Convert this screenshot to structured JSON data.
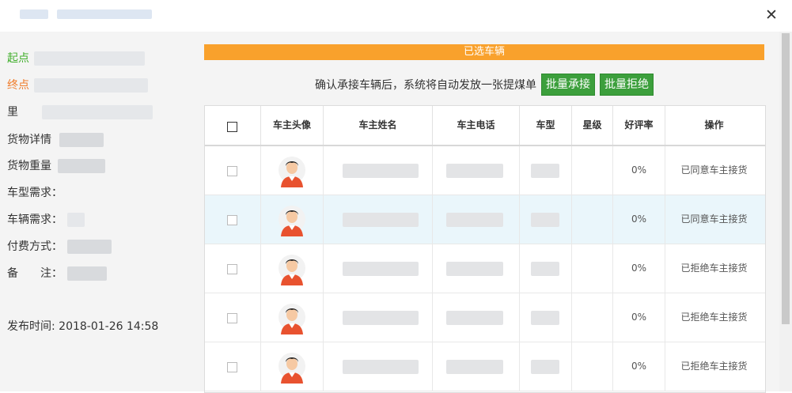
{
  "window": {
    "title_tab1": "",
    "title_tab2": ""
  },
  "left_panel": {
    "start_label": "起点",
    "end_label": "终点",
    "distance_label": "里",
    "cargo_detail_label": "货物详情",
    "cargo_weight_label": "货物重量",
    "vehicle_type_label": "车型需求：",
    "vehicle_count_label": "车辆需求：",
    "payment_label": "付费方式：",
    "remark_label": "备　　注：",
    "publish_time": "发布时间: 2018-01-26 14:58"
  },
  "right_panel": {
    "banner": "已选车辆",
    "confirm_text": "确认承接车辆后，系统将自动发放一张提煤单",
    "batch_accept": "批量承接",
    "batch_reject": "批量拒绝",
    "columns": [
      "车主头像",
      "车主姓名",
      "车主电话",
      "车型",
      "星级",
      "好评率",
      "操作"
    ],
    "rows": [
      {
        "rate": "0%",
        "action": "已同意车主接货",
        "highlight": false
      },
      {
        "rate": "0%",
        "action": "已同意车主接货",
        "highlight": true
      },
      {
        "rate": "0%",
        "action": "已拒绝车主接货",
        "highlight": false
      },
      {
        "rate": "0%",
        "action": "已拒绝车主接货",
        "highlight": false
      },
      {
        "rate": "0%",
        "action": "已拒绝车主接货",
        "highlight": false
      }
    ]
  },
  "icons": {
    "close": "close-icon",
    "avatar": "driver-avatar-icon"
  },
  "colors": {
    "banner": "#f9a12c",
    "button": "#3c9f3c",
    "start": "#3fae2a",
    "end": "#f07c2a",
    "highlight_row": "#eaf6fb"
  }
}
